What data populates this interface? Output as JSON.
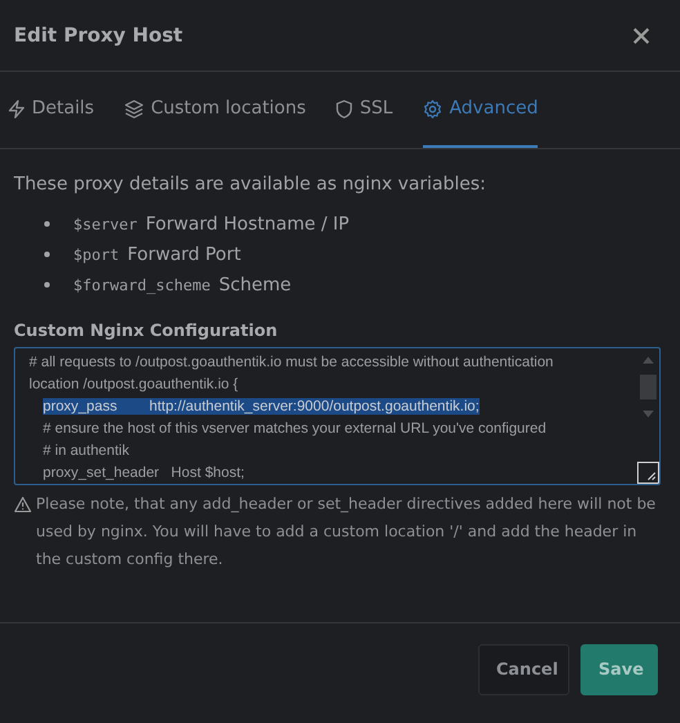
{
  "title": "Edit Proxy Host",
  "tabs": [
    {
      "label": "Details",
      "selected": false
    },
    {
      "label": "Custom locations",
      "selected": false
    },
    {
      "label": "SSL",
      "selected": false
    },
    {
      "label": "Advanced",
      "selected": true
    }
  ],
  "intro": "These proxy details are available as nginx variables:",
  "variables": [
    {
      "name": "$server",
      "description": "Forward Hostname / IP"
    },
    {
      "name": "$port",
      "description": "Forward Port"
    },
    {
      "name": "$forward_scheme",
      "description": "Scheme"
    }
  ],
  "config_label": "Custom Nginx Configuration",
  "config_lines": [
    {
      "text": "# all requests to /outpost.goauthentik.io must be accessible without authentication",
      "selected": false
    },
    {
      "text": "location /outpost.goauthentik.io {",
      "selected": false,
      "children": [
        {
          "text": "proxy_pass        http://authentik_server:9000/outpost.goauthentik.io;",
          "selected": true
        },
        {
          "text": "# ensure the host of this vserver matches your external URL you've configured",
          "selected": false
        },
        {
          "text": "# in authentik",
          "selected": false
        },
        {
          "text": "proxy_set_header   Host $host;",
          "selected": false
        }
      ]
    }
  ],
  "note": "Please note, that any add_header or set_header directives added here will not be used by nginx. You will have to add a custom location '/' and add the header in the custom config there.",
  "buttons": [
    {
      "label": "Cancel",
      "kind": "secondary"
    },
    {
      "label": "Save",
      "kind": "primary"
    }
  ]
}
